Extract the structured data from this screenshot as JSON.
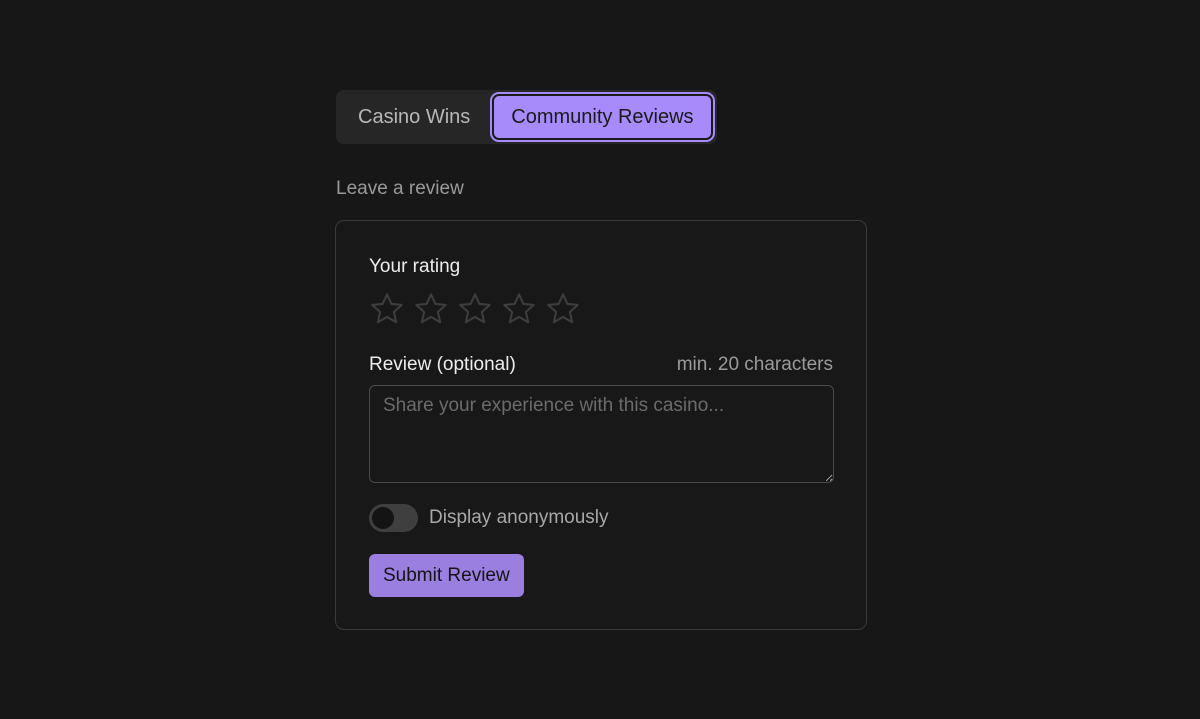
{
  "tabs": [
    {
      "label": "Casino Wins",
      "active": false
    },
    {
      "label": "Community Reviews",
      "active": true
    }
  ],
  "section": {
    "heading": "Leave a review"
  },
  "form": {
    "rating_label": "Your rating",
    "rating_value": 0,
    "rating_max": 5,
    "review_label": "Review (optional)",
    "review_hint": "min. 20 characters",
    "review_value": "",
    "review_placeholder": "Share your experience with this casino...",
    "anonymous_label": "Display anonymously",
    "anonymous_enabled": false,
    "submit_label": "Submit Review"
  },
  "icons": {
    "star": "star-outline-icon"
  },
  "colors": {
    "accent": "#a78bfa",
    "button": "#9b7fe0",
    "background": "#171717",
    "star_outline": "#3d3d3d"
  }
}
